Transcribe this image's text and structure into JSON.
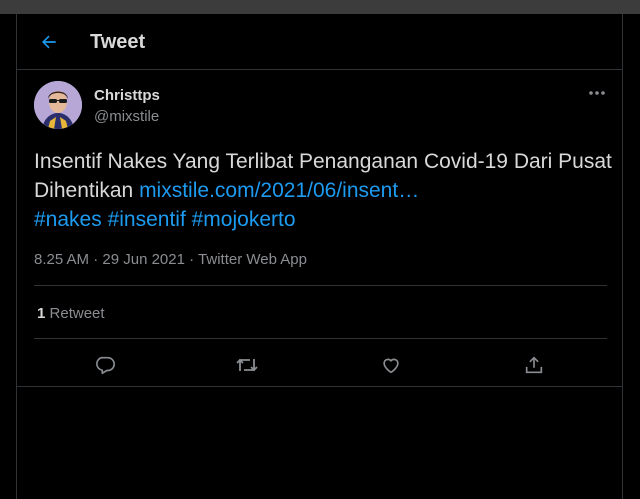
{
  "header": {
    "title": "Tweet"
  },
  "tweet": {
    "display_name": "Christtps",
    "handle": "@mixstile",
    "text_before": "Insentif Nakes Yang Terlibat Penanganan Covid-19 Dari Pusat Dihentikan ",
    "link": "mixstile.com/2021/06/insent…",
    "hashtags": [
      "#nakes",
      "#insentif",
      "#mojokerto"
    ],
    "time": "8.25 AM",
    "date": "29 Jun 2021",
    "source": "Twitter Web App",
    "retweet_count": "1",
    "retweet_label": "Retweet"
  },
  "colors": {
    "accent": "#1d9bf0",
    "background": "#000000",
    "border": "#2f3336",
    "muted": "#8a8d91"
  },
  "icons": [
    "back-arrow-icon",
    "more-icon",
    "reply-icon",
    "retweet-icon",
    "like-icon",
    "share-icon"
  ]
}
